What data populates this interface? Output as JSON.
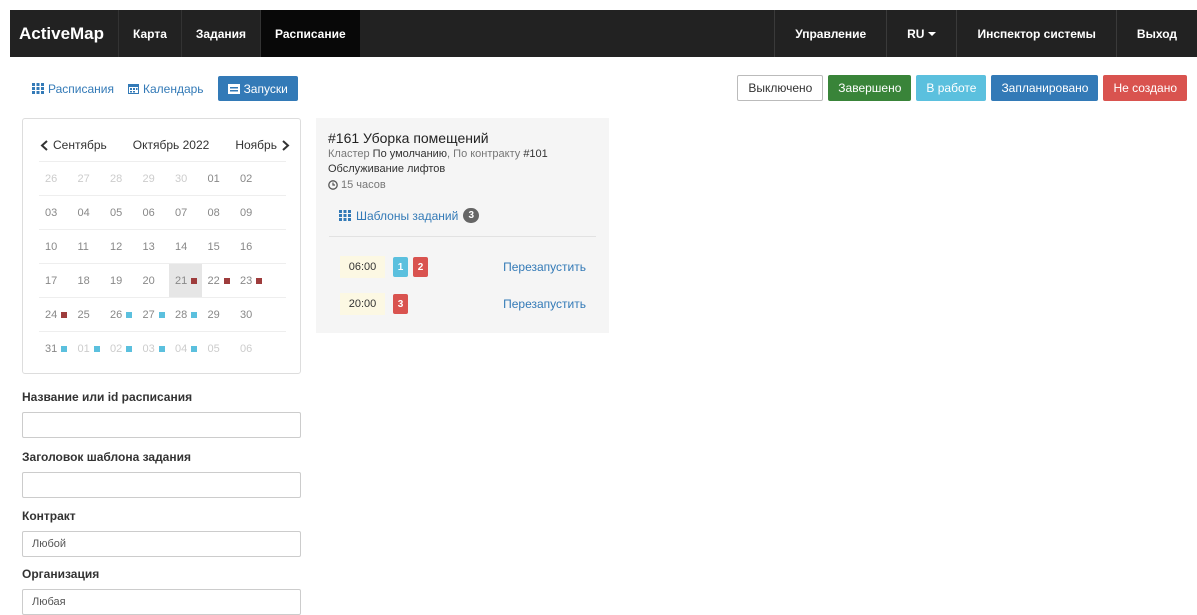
{
  "navbar": {
    "brand": "ActiveMap",
    "left_items": [
      "Карта",
      "Задания",
      "Расписание"
    ],
    "active": "Расписание",
    "right_items": [
      "Управление",
      "RU",
      "Инспектор системы",
      "Выход"
    ]
  },
  "toolbar": {
    "schedules_label": "Расписания",
    "calendar_label": "Календарь",
    "runs_label": "Запуски"
  },
  "statuses": {
    "off": "Выключено",
    "done": "Завершено",
    "work": "В работе",
    "plan": "Запланировано",
    "none": "Не создано"
  },
  "calendar": {
    "prev": "Сентябрь",
    "current": "Октябрь 2022",
    "next": "Ноябрь",
    "weeks": [
      [
        {
          "d": "26",
          "o": true
        },
        {
          "d": "27",
          "o": true
        },
        {
          "d": "28",
          "o": true
        },
        {
          "d": "29",
          "o": true
        },
        {
          "d": "30",
          "o": true
        },
        {
          "d": "01"
        },
        {
          "d": "02"
        }
      ],
      [
        {
          "d": "03"
        },
        {
          "d": "04"
        },
        {
          "d": "05"
        },
        {
          "d": "06"
        },
        {
          "d": "07"
        },
        {
          "d": "08"
        },
        {
          "d": "09"
        }
      ],
      [
        {
          "d": "10"
        },
        {
          "d": "11"
        },
        {
          "d": "12"
        },
        {
          "d": "13"
        },
        {
          "d": "14"
        },
        {
          "d": "15"
        },
        {
          "d": "16"
        }
      ],
      [
        {
          "d": "17"
        },
        {
          "d": "18"
        },
        {
          "d": "19"
        },
        {
          "d": "20"
        },
        {
          "d": "21",
          "m": "red",
          "t": true
        },
        {
          "d": "22",
          "m": "red"
        },
        {
          "d": "23",
          "m": "red"
        }
      ],
      [
        {
          "d": "24",
          "m": "red"
        },
        {
          "d": "25"
        },
        {
          "d": "26",
          "m": "blue"
        },
        {
          "d": "27",
          "m": "blue"
        },
        {
          "d": "28",
          "m": "blue"
        },
        {
          "d": "29"
        },
        {
          "d": "30"
        }
      ],
      [
        {
          "d": "31",
          "m": "blue"
        },
        {
          "d": "01",
          "o": true,
          "m": "blue"
        },
        {
          "d": "02",
          "o": true,
          "m": "blue"
        },
        {
          "d": "03",
          "o": true,
          "m": "blue"
        },
        {
          "d": "04",
          "o": true,
          "m": "blue"
        },
        {
          "d": "05",
          "o": true
        },
        {
          "d": "06",
          "o": true
        }
      ]
    ]
  },
  "filters": {
    "name_label": "Название или id расписания",
    "name_value": "",
    "template_label": "Заголовок шаблона задания",
    "template_value": "",
    "contract_label": "Контракт",
    "contract_value": "Любой",
    "org_label": "Организация",
    "org_value": "Любая"
  },
  "schedule": {
    "title": "#161 Уборка помещений",
    "cluster_prefix": "Кластер",
    "cluster": "По умолчанию",
    "contract_prefix": ", По контракту",
    "contract": "#101",
    "service": "Обслуживание лифтов",
    "duration": "15 часов",
    "templates_label": "Шаблоны заданий",
    "templates_count": "3",
    "runs": [
      {
        "time": "06:00",
        "counts": [
          {
            "n": "1",
            "c": "info"
          },
          {
            "n": "2",
            "c": "danger"
          }
        ],
        "action": "Перезапустить"
      },
      {
        "time": "20:00",
        "counts": [
          {
            "n": "3",
            "c": "danger"
          }
        ],
        "action": "Перезапустить"
      }
    ]
  }
}
